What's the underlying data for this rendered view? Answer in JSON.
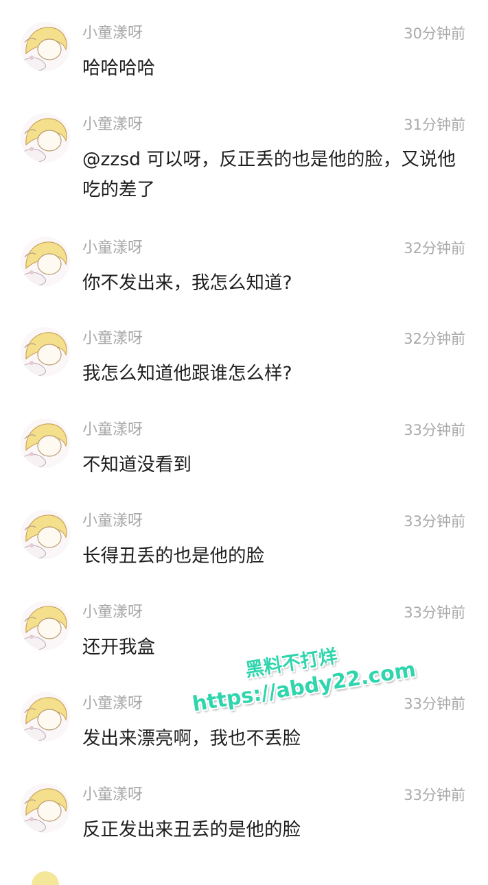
{
  "comments": [
    {
      "username": "小童漾呀",
      "time": "30分钟前",
      "text": "哈哈哈哈"
    },
    {
      "username": "小童漾呀",
      "time": "31分钟前",
      "text": "@zzsd 可以呀，反正丢的也是他的脸，又说他吃的差了"
    },
    {
      "username": "小童漾呀",
      "time": "32分钟前",
      "text": "你不发出来，我怎么知道?"
    },
    {
      "username": "小童漾呀",
      "time": "32分钟前",
      "text": "我怎么知道他跟谁怎么样?"
    },
    {
      "username": "小童漾呀",
      "time": "33分钟前",
      "text": "不知道没看到"
    },
    {
      "username": "小童漾呀",
      "time": "33分钟前",
      "text": "长得丑丢的也是他的脸"
    },
    {
      "username": "小童漾呀",
      "time": "33分钟前",
      "text": "还开我盒"
    },
    {
      "username": "小童漾呀",
      "time": "33分钟前",
      "text": "发出来漂亮啊，我也不丢脸"
    },
    {
      "username": "小童漾呀",
      "time": "33分钟前",
      "text": "反正发出来丑丢的是他的脸"
    }
  ],
  "watermark": {
    "line1": "黑料不打烊",
    "line2": "https://abdy22.com"
  },
  "colors": {
    "meta_text": "#a9a9a9",
    "body_text": "#1f1f1f",
    "watermark": "#2fd5ad",
    "avatar_hair": "#f4e08c"
  }
}
